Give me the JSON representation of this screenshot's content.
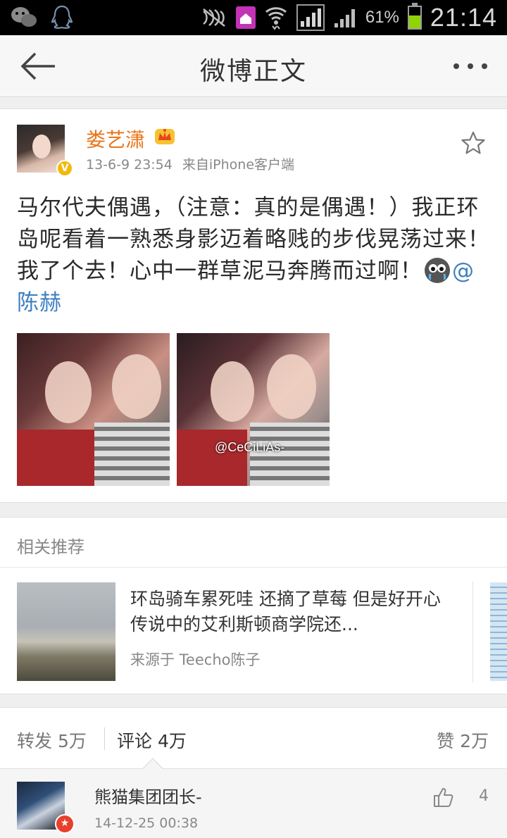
{
  "status_bar": {
    "battery": "61%",
    "battery_level": 0.61,
    "time": "21:14"
  },
  "navbar": {
    "title": "微博正文"
  },
  "post": {
    "author": "娄艺潇",
    "time": "13-6-9 23:54",
    "source": "来自iPhone客户端",
    "text": "马尔代夫偶遇，（注意：真的是偶遇！）我正环岛呢看着一熟悉身影迈着略贱的步伐晃荡过来！我了个去！心中一群草泥马奔腾而过啊！",
    "mention": "@陈赫",
    "photo_watermark": "@CeCiLiAs-"
  },
  "related": {
    "title": "相关推荐",
    "item": {
      "text": "环岛骑车累死哇 还摘了草莓 但是好开心 传说中的艾利斯顿商学院还...",
      "source": "来源于 Teecho陈子"
    }
  },
  "actions": {
    "repost": "转发 5万",
    "comment": "评论 4万",
    "like": "赞 2万"
  },
  "comment": {
    "name": "熊猫集团团长-",
    "time": "14-12-25 00:38",
    "likes": "4"
  },
  "colors": {
    "username": "#e8751a",
    "mention": "#3e7fc1",
    "battery": "#8fd400"
  }
}
